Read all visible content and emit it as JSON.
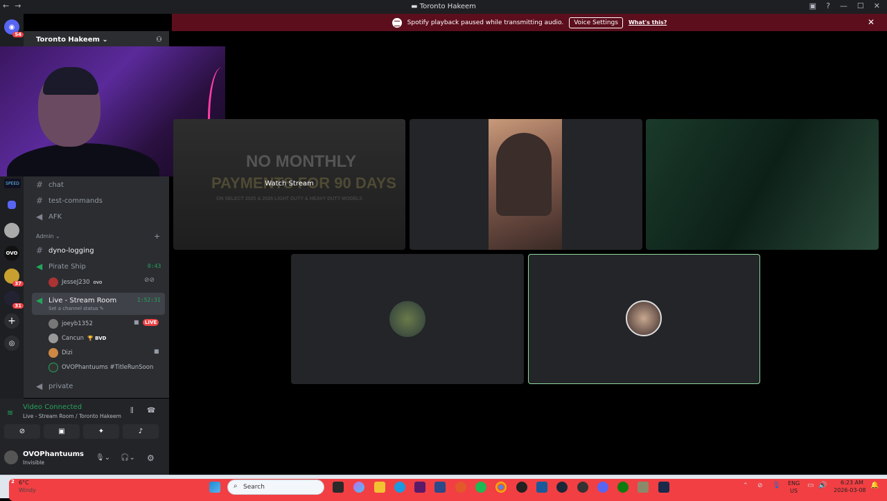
{
  "titlebar": {
    "title": "Toronto Hakeem",
    "back": "←",
    "forward": "→"
  },
  "banner": {
    "message": "Spotify playback paused while transmitting audio.",
    "button": "Voice Settings",
    "link": "What's this?"
  },
  "guilds": {
    "home_badge": "54",
    "badge_37": "37",
    "badge_31": "31",
    "ovo_label": "OVO",
    "speed_label": "SPEED"
  },
  "server": {
    "name": "Toronto Hakeem"
  },
  "channels": {
    "chat": "chat",
    "test_commands": "test-commands",
    "afk": "AFK",
    "admin_category": "Admin",
    "dyno_logging": "dyno-logging",
    "pirate_ship": "Pirate Ship",
    "pirate_time": "0:43",
    "pirate_user": "JesseJ230",
    "pirate_user_tag": "ovo",
    "live_room": "Live - Stream Room",
    "live_time": "1:52:31",
    "live_status": "Set a channel status",
    "users": [
      {
        "name": "joeyb1352",
        "badge": "LIVE"
      },
      {
        "name": "Cancun",
        "tag": "BVD"
      },
      {
        "name": "Dizi"
      },
      {
        "name": "OVOPhantuums #TitleRunSoon"
      }
    ],
    "private": "private"
  },
  "voice": {
    "status": "Video Connected",
    "location": "Live - Stream Room / Toronto Hakeem"
  },
  "user_panel": {
    "name": "OVOPhantuums",
    "status": "Invisible"
  },
  "stage": {
    "watch_stream": "Watch Stream",
    "ad_line1": "NO MONTHLY",
    "ad_line2": "PAYMENTS FOR 90 DAYS",
    "ad_line3": "ON SELECT 2025 & 2026 LIGHT DUTY & HEAVY DUTY MODELS"
  },
  "taskbar": {
    "weather_temp": "6°C",
    "weather_desc": "Windy",
    "search": "Search",
    "lang": "ENG",
    "region": "US",
    "time": "6:23 AM",
    "date": "2026-03-08"
  },
  "colors": {
    "accent": "#5865f2",
    "green": "#23a55a",
    "banner": "#5c0e1c",
    "live": "#ed4245"
  }
}
